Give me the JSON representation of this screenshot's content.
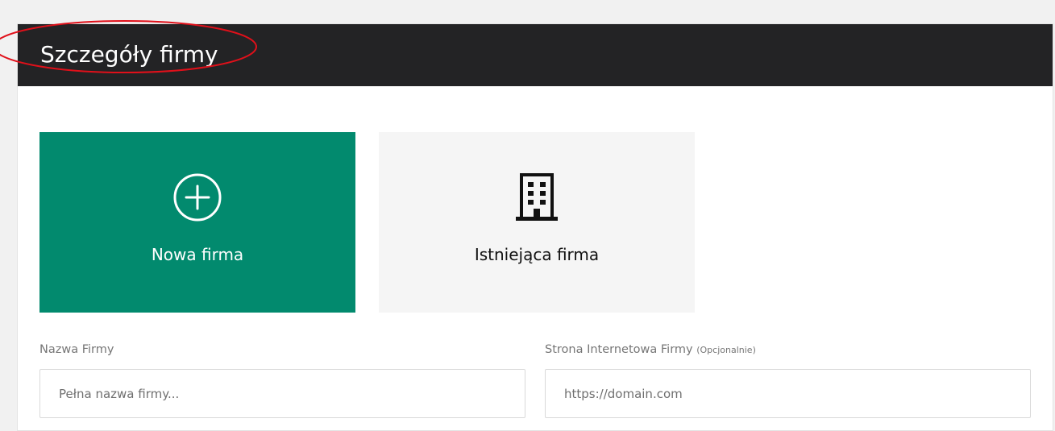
{
  "header": {
    "title": "Szczegóły firmy"
  },
  "annotation": {
    "color": "#e0101a"
  },
  "choices": {
    "new_company": {
      "label": "Nowa firma",
      "icon": "plus-circle-icon",
      "color": "#028a6e"
    },
    "existing_company": {
      "label": "Istniejąca firma",
      "icon": "building-icon"
    }
  },
  "form": {
    "company_name": {
      "label": "Nazwa Firmy",
      "placeholder": "Pełna nazwa firmy...",
      "value": ""
    },
    "company_website": {
      "label": "Strona Internetowa Firmy",
      "hint": "(Opcjonalnie)",
      "placeholder": "https://domain.com",
      "value": ""
    }
  }
}
